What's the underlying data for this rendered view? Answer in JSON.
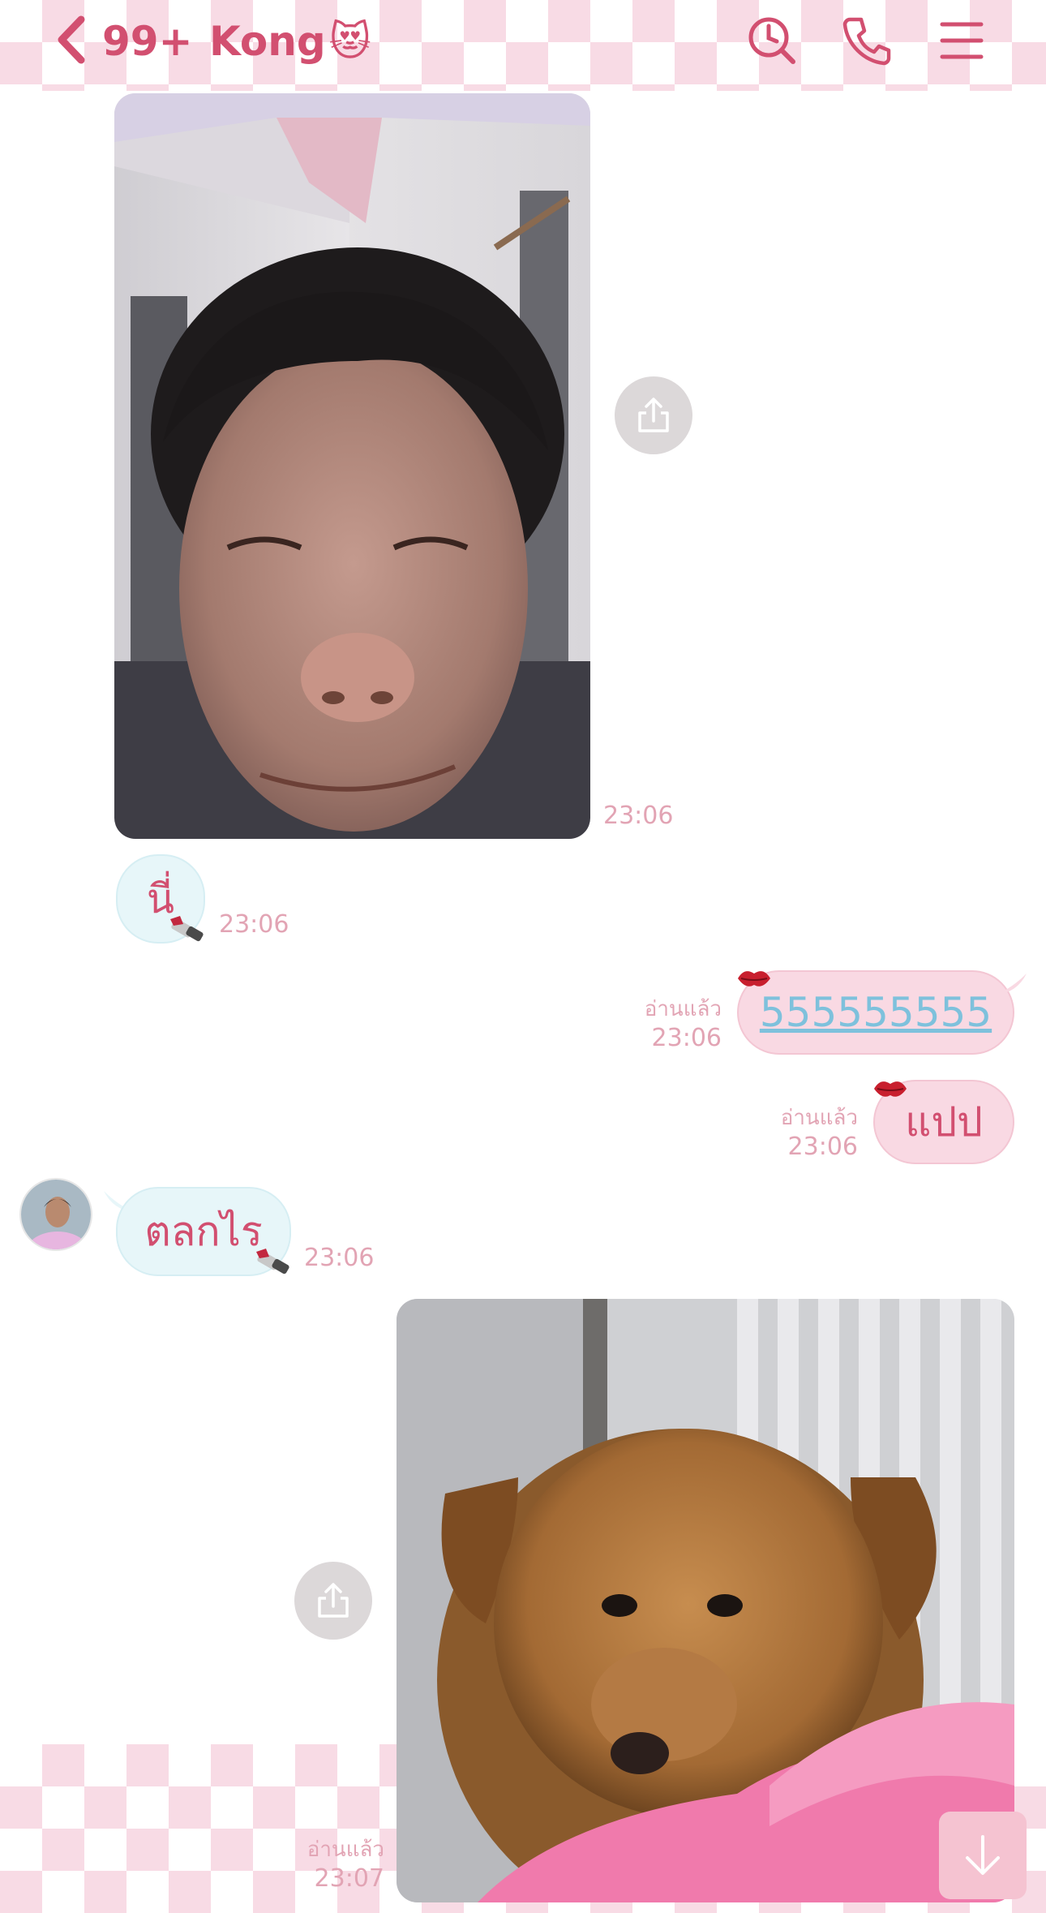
{
  "header": {
    "unread_count": "99+",
    "contact_name": "Kong",
    "contact_emoji": "😻",
    "icons": [
      "back-chevron-icon",
      "search-history-icon",
      "phone-icon",
      "menu-icon"
    ]
  },
  "theme": {
    "accent": "#d24f70",
    "checker_pink": "#f8dbe5",
    "incoming_bubble": "#e7f6f9",
    "outgoing_bubble": "#f9d9e3",
    "time_color": "#e2a4b4"
  },
  "messages": [
    {
      "type": "image",
      "direction": "incoming",
      "subject": "selfie",
      "time": "23:06"
    },
    {
      "type": "text",
      "direction": "incoming",
      "text": "นี่",
      "time": "23:06"
    },
    {
      "type": "text",
      "direction": "outgoing",
      "text": "555555555",
      "is_link": true,
      "read": "อ่านแล้ว",
      "time": "23:06"
    },
    {
      "type": "text",
      "direction": "outgoing",
      "text": "แปป",
      "read": "อ่านแล้ว",
      "time": "23:06"
    },
    {
      "type": "text",
      "direction": "incoming",
      "text": "ตลกไร",
      "time": "23:06"
    },
    {
      "type": "image",
      "direction": "outgoing",
      "subject": "puppy",
      "read": "อ่านแล้ว",
      "time": "23:07"
    }
  ]
}
